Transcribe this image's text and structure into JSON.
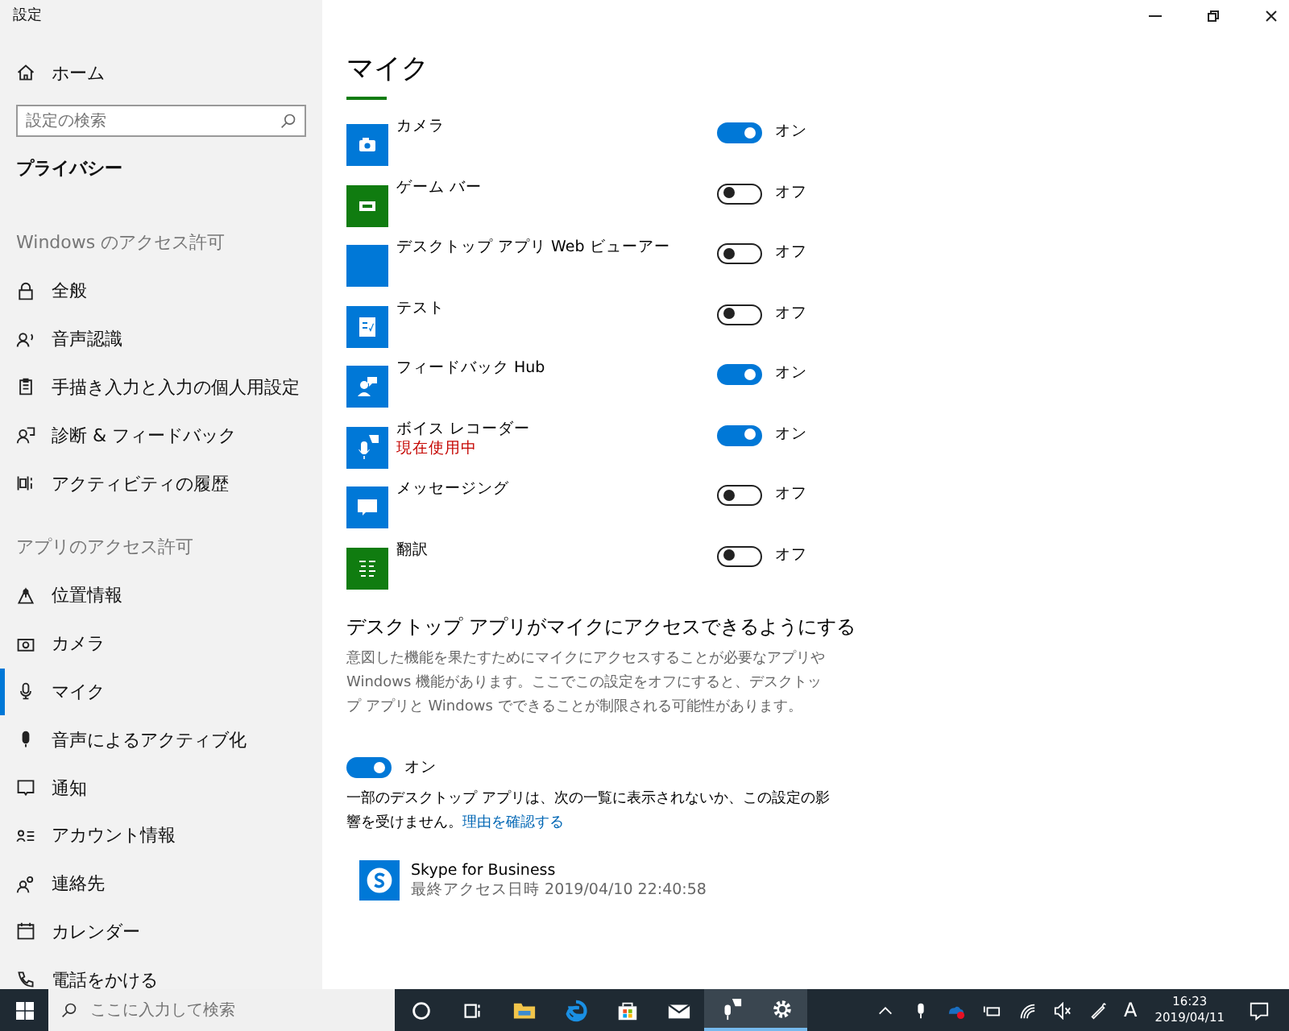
{
  "window": {
    "title": "設定"
  },
  "sidebar": {
    "home": {
      "label": "ホーム",
      "kind": "home"
    },
    "search": {
      "placeholder": "設定の検索"
    },
    "heading": "プライバシー",
    "groups": [
      {
        "title": "Windows のアクセス許可",
        "items": [
          {
            "label": "全般",
            "kind": "lock",
            "selected": false
          },
          {
            "label": "音声認識",
            "kind": "speech",
            "selected": false
          },
          {
            "label": "手描き入力と入力の個人用設定",
            "kind": "clipboard",
            "selected": false
          },
          {
            "label": "診断 & フィードバック",
            "kind": "feedback",
            "selected": false
          },
          {
            "label": "アクティビティの履歴",
            "kind": "timeline",
            "selected": false
          }
        ]
      },
      {
        "title": "アプリのアクセス許可",
        "items": [
          {
            "label": "位置情報",
            "kind": "location",
            "selected": false
          },
          {
            "label": "カメラ",
            "kind": "camera",
            "selected": false
          },
          {
            "label": "マイク",
            "kind": "mic",
            "selected": true
          },
          {
            "label": "音声によるアクティブ化",
            "kind": "voice",
            "selected": false
          },
          {
            "label": "通知",
            "kind": "notification",
            "selected": false
          },
          {
            "label": "アカウント情報",
            "kind": "account",
            "selected": false
          },
          {
            "label": "連絡先",
            "kind": "contacts",
            "selected": false
          },
          {
            "label": "カレンダー",
            "kind": "calendar",
            "selected": false
          },
          {
            "label": "電話をかける",
            "kind": "phone",
            "selected": false
          }
        ]
      }
    ]
  },
  "main": {
    "title": "マイク",
    "apps": [
      {
        "name": "カメラ",
        "kind": "camera",
        "color": "#0078d7",
        "on": true,
        "state_label": "オン"
      },
      {
        "name": "ゲーム バー",
        "kind": "gamebar",
        "color": "#107c10",
        "on": false,
        "state_label": "オフ"
      },
      {
        "name": "デスクトップ アプリ Web ビューアー",
        "kind": "blank",
        "color": "#0078d7",
        "on": false,
        "state_label": "オフ"
      },
      {
        "name": "テスト",
        "kind": "test",
        "color": "#0078d7",
        "on": false,
        "state_label": "オフ"
      },
      {
        "name": "フィードバック Hub",
        "kind": "feedback",
        "color": "#0078d7",
        "on": true,
        "state_label": "オン"
      },
      {
        "name": "ボイス レコーダー",
        "status": "現在使用中",
        "kind": "recorder",
        "color": "#0078d7",
        "on": true,
        "state_label": "オン"
      },
      {
        "name": "メッセージング",
        "kind": "messaging",
        "color": "#0078d7",
        "on": false,
        "state_label": "オフ"
      },
      {
        "name": "翻訳",
        "kind": "translator",
        "color": "#107c10",
        "on": false,
        "state_label": "オフ"
      }
    ],
    "desktop": {
      "heading": "デスクトップ アプリがマイクにアクセスできるようにする",
      "description": "意図した機能を果たすためにマイクにアクセスすることが必要なアプリや Windows 機能があります。ここでこの設定をオフにすると、デスクトップ アプリと Windows でできることが制限される可能性があります。",
      "toggle": {
        "on": true,
        "label": "オン"
      },
      "note": "一部のデスクトップ アプリは、次の一覧に表示されないか、この設定の影響を受けません。",
      "link": "理由を確認する",
      "apps": [
        {
          "name": "Skype for Business",
          "last_access": "最終アクセス日時 2019/04/10 22:40:58"
        }
      ]
    }
  },
  "taskbar": {
    "search": {
      "placeholder": "ここに入力して検索"
    },
    "apps": [
      {
        "kind": "cortana",
        "active": false
      },
      {
        "kind": "taskview",
        "active": false
      },
      {
        "kind": "explorer",
        "active": false
      },
      {
        "kind": "edge",
        "active": false
      },
      {
        "kind": "store",
        "active": false
      },
      {
        "kind": "mail",
        "active": false
      },
      {
        "kind": "recorder",
        "active": true
      },
      {
        "kind": "settings",
        "active": true
      }
    ],
    "ime": "A",
    "time": "16:23",
    "date": "2019/04/11"
  }
}
